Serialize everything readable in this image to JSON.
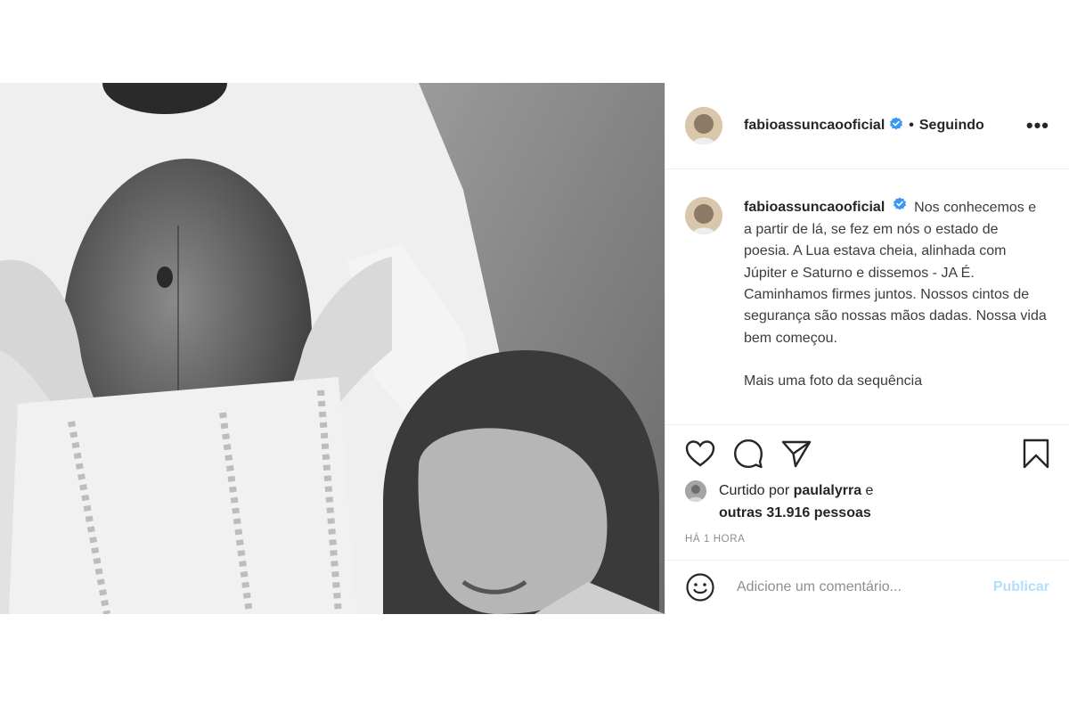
{
  "post": {
    "username": "fabioassuncaooficial",
    "follow_status": "Seguindo",
    "more_label": "•••",
    "caption": {
      "username": "fabioassuncaooficial",
      "text": "Nos conhecemos e a partir de lá, se fez em nós o estado de poesia. A Lua estava cheia, alinhada com Júpiter e Saturno e dissemos - JA É. Caminhamos firmes juntos. Nossos cintos de segurança são nossas mãos dadas. Nossa vida bem começou.",
      "more_text": "Mais uma foto da sequência"
    },
    "likes": {
      "prefix": "Curtido por",
      "first_liker": "paulalyrra",
      "connector": "e",
      "others": "outras 31.916 pessoas"
    },
    "time_ago": "HÁ 1 HORA",
    "comment": {
      "placeholder": "Adicione um comentário...",
      "publish_label": "Publicar"
    },
    "icons": {
      "verified": "verified-badge-icon",
      "like": "heart-icon",
      "comment": "comment-icon",
      "share": "paper-plane-icon",
      "save": "bookmark-icon",
      "emoji": "emoji-icon"
    },
    "colors": {
      "verified": "#3897f0",
      "publish": "#b2dffc",
      "muted": "#8e8e8e",
      "text": "#262626"
    }
  }
}
